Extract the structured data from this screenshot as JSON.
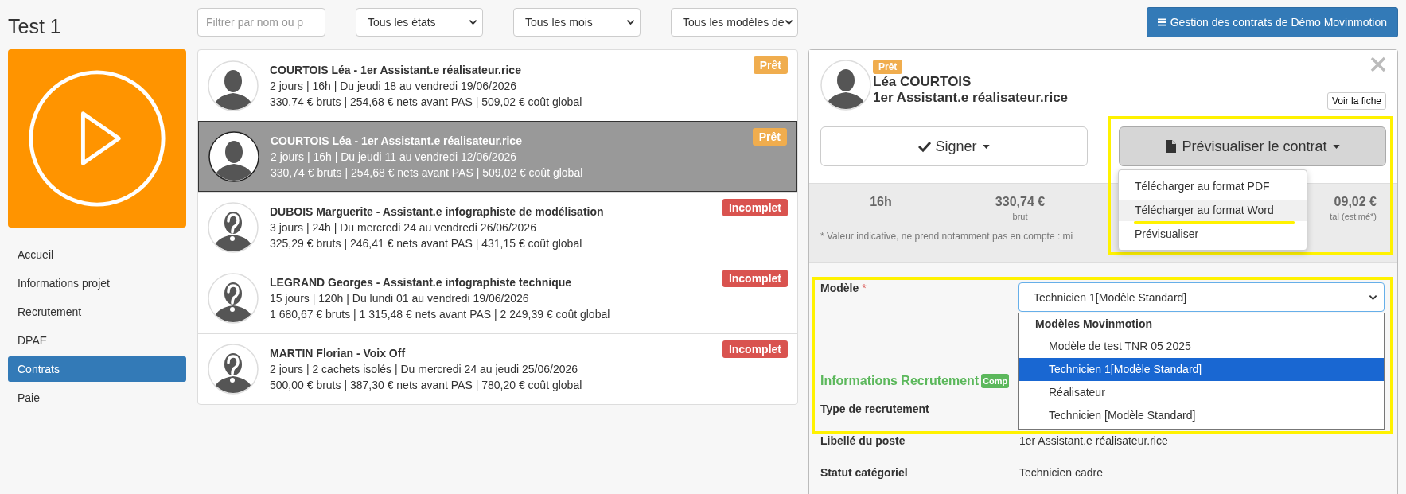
{
  "project": {
    "title": "Test 1"
  },
  "sidebar": {
    "items": [
      {
        "label": "Accueil",
        "selected": false
      },
      {
        "label": "Informations projet",
        "selected": false
      },
      {
        "label": "Recrutement",
        "selected": false
      },
      {
        "label": "DPAE",
        "selected": false
      },
      {
        "label": "Contrats",
        "selected": true
      },
      {
        "label": "Paie",
        "selected": false
      }
    ]
  },
  "filters": {
    "search": {
      "placeholder": "Filtrer par nom ou p"
    },
    "selects": [
      "Tous les états",
      "Tous les mois",
      "Tous les modèles de"
    ]
  },
  "header_button": {
    "label": "Gestion des contrats de Démo Movinmotion"
  },
  "contracts": [
    {
      "title": "COURTOIS Léa - 1er Assistant.e réalisateur.rice",
      "details": "2 jours | 16h | Du jeudi 18 au vendredi 19/06/2026",
      "amounts": "330,74 € bruts | 254,68 € nets avant PAS | 509,02 € coût global",
      "status": {
        "kind": "ready",
        "label": "Prêt"
      },
      "avatar": {
        "kind": "person"
      },
      "selected": false
    },
    {
      "title": "COURTOIS Léa - 1er Assistant.e réalisateur.rice",
      "details": "2 jours | 16h | Du jeudi 11 au vendredi 12/06/2026",
      "amounts": "330,74 € bruts | 254,68 € nets avant PAS | 509,02 € coût global",
      "status": {
        "kind": "ready",
        "label": "Prêt"
      },
      "avatar": {
        "kind": "person"
      },
      "selected": true
    },
    {
      "title": "DUBOIS Marguerite - Assistant.e infographiste de modélisation",
      "details": "3 jours | 24h | Du mercredi 24 au vendredi 26/06/2026",
      "amounts": "325,29 € bruts | 246,41 € nets avant PAS | 431,15 € coût global",
      "status": {
        "kind": "incomplete",
        "label": "Incomplet"
      },
      "avatar": {
        "kind": "unknown"
      },
      "selected": false
    },
    {
      "title": "LEGRAND Georges - Assistant.e infographiste technique",
      "details": "15 jours | 120h | Du lundi 01 au vendredi 19/06/2026",
      "amounts": "1 680,67 € bruts | 1 315,48 € nets avant PAS | 2 249,39 € coût global",
      "status": {
        "kind": "incomplete",
        "label": "Incomplet"
      },
      "avatar": {
        "kind": "unknown"
      },
      "selected": false
    },
    {
      "title": "MARTIN Florian - Voix Off",
      "details": "2 jours | 2 cachets isolés | Du mercredi 24 au jeudi 25/06/2026",
      "amounts": "500,00 € bruts | 387,30 € nets avant PAS | 780,20 € coût global",
      "status": {
        "kind": "incomplete",
        "label": "Incomplet"
      },
      "avatar": {
        "kind": "unknown"
      },
      "selected": false
    }
  ],
  "detail": {
    "status": {
      "kind": "ready",
      "label": "Prêt"
    },
    "avatar": {
      "kind": "person"
    },
    "name": "Léa COURTOIS",
    "role": "1er Assistant.e réalisateur.rice",
    "profile_button": "Voir la fiche",
    "sign_button": "Signer",
    "preview_button": "Prévisualiser le contrat",
    "preview_menu": {
      "open": true,
      "items": [
        {
          "label": "Télécharger au format PDF",
          "selected": false
        },
        {
          "label": "Télécharger au format Word",
          "selected": true
        },
        {
          "label": "Prévisualiser",
          "selected": false
        }
      ]
    },
    "stats": [
      {
        "value": "16h"
      },
      {
        "value": "330,74 €",
        "label": "brut"
      },
      {
        "value": "09,02 €",
        "label": "tal (estimé*)"
      }
    ],
    "note": "* Valeur indicative, ne prend notamment pas en compte : mi",
    "model_field": {
      "label": "Modèle",
      "required": true,
      "required_mark": "*",
      "value": "Technicien 1[Modèle Standard]",
      "open": true,
      "group": "Modèles Movinmotion",
      "options": [
        {
          "label": "Modèle de test TNR 05 2025",
          "selected": false
        },
        {
          "label": "Technicien 1[Modèle Standard]",
          "selected": true
        },
        {
          "label": "Réalisateur",
          "selected": false
        },
        {
          "label": "Technicien [Modèle Standard]",
          "selected": false
        }
      ]
    },
    "recruitment": {
      "heading": "Informations Recrutement",
      "badge": "Comp"
    },
    "fields": [
      {
        "label": "Type de recrutement"
      },
      {
        "label": "Libellé du poste",
        "value": "1er Assistant.e réalisateur.rice"
      },
      {
        "label": "Statut catégoriel",
        "value": "Technicien cadre"
      }
    ]
  }
}
